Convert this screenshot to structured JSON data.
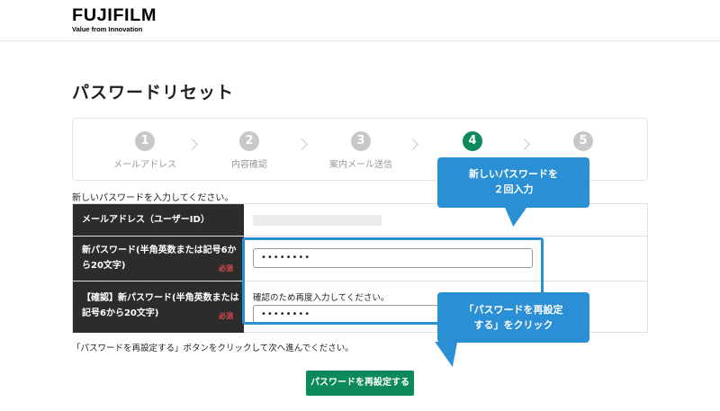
{
  "header": {
    "logo_main": "FUJIFILM",
    "logo_sub": "Value from Innovation"
  },
  "page": {
    "title": "パスワードリセット",
    "intro": "新しいパスワードを入力してください。",
    "bottom_note": "「パスワードを再設定する」ボタンをクリックして次へ進んでください。"
  },
  "stepper": {
    "steps": [
      {
        "number": "1",
        "label": "メールアドレス",
        "active": false
      },
      {
        "number": "2",
        "label": "内容確認",
        "active": false
      },
      {
        "number": "3",
        "label": "案内メール送信",
        "active": false
      },
      {
        "number": "4",
        "label": "",
        "active": true
      },
      {
        "number": "5",
        "label": "",
        "active": false
      }
    ]
  },
  "form": {
    "email_label": "メールアドレス（ユーザーID）",
    "new_password_label_line1": "新パスワード(半角英数または記号6か",
    "new_password_label_line2": "ら20文字)",
    "new_password_value": "••••••••",
    "confirm_label_line1": "【確認】新パスワード(半角英数または",
    "confirm_label_line2": "記号6から20文字)",
    "confirm_hint": "確認のため再度入力してください。",
    "confirm_value": "••••••••",
    "required_badge": "必須"
  },
  "buttons": {
    "submit_label": "パスワードを再設定する"
  },
  "callouts": {
    "callout1_line1": "新しいパスワードを",
    "callout1_line2": "２回入力",
    "callout2_line1": "「パスワードを再設定",
    "callout2_line2": "する」をクリック"
  },
  "colors": {
    "brand_green": "#0d8a5b",
    "callout_blue": "#2a8fd4",
    "label_dark": "#2c2c2c",
    "required_red": "#e0474c"
  }
}
